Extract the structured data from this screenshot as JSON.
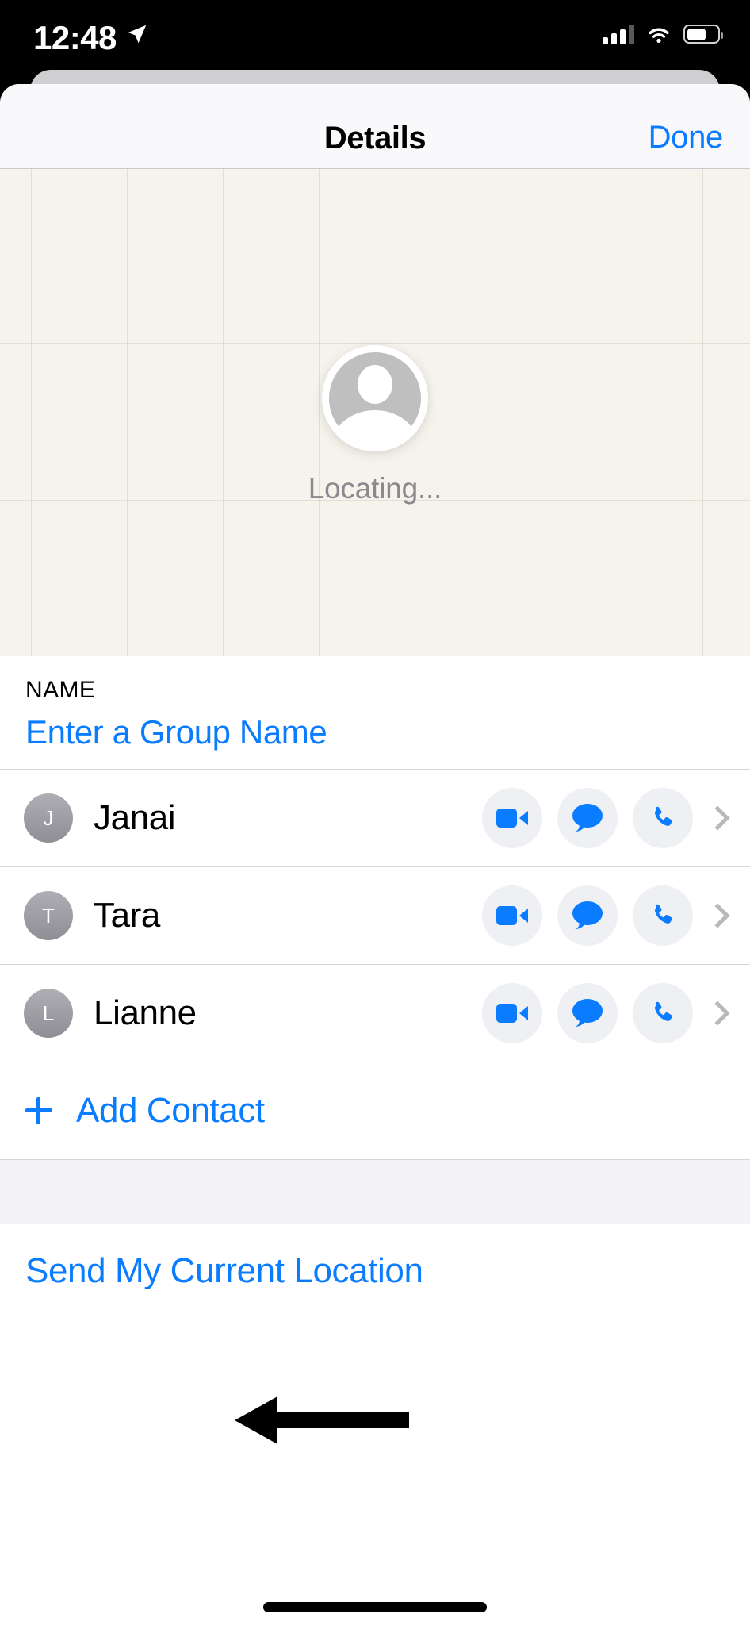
{
  "status_bar": {
    "time": "12:48",
    "location_arrow_icon": "location-arrow-icon",
    "cellular_icon": "cellular-bars-icon",
    "wifi_icon": "wifi-icon",
    "battery_icon": "battery-icon",
    "battery_level_percent": 57
  },
  "nav": {
    "title": "Details",
    "done_label": "Done"
  },
  "map": {
    "status_text": "Locating...",
    "avatar_icon": "person-placeholder-icon"
  },
  "name_section": {
    "header": "NAME",
    "placeholder": "Enter a Group Name",
    "value": ""
  },
  "contacts": [
    {
      "initial": "J",
      "name": "Janai",
      "actions": [
        "facetime-video-icon",
        "message-bubble-icon",
        "phone-icon"
      ],
      "disclosure": "chevron-right-icon"
    },
    {
      "initial": "T",
      "name": "Tara",
      "actions": [
        "facetime-video-icon",
        "message-bubble-icon",
        "phone-icon"
      ],
      "disclosure": "chevron-right-icon"
    },
    {
      "initial": "L",
      "name": "Lianne",
      "actions": [
        "facetime-video-icon",
        "message-bubble-icon",
        "phone-icon"
      ],
      "disclosure": "chevron-right-icon"
    }
  ],
  "add_contact": {
    "label": "Add Contact",
    "icon": "plus-icon"
  },
  "location_section": {
    "send_label": "Send My Current Location"
  },
  "annotation": {
    "arrow_icon": "left-pointing-arrow-annotation",
    "target": "Add Contact"
  },
  "colors": {
    "accent_blue": "#0a7cff",
    "map_background": "#f6f3ec",
    "action_pill": "#eff0f4",
    "separator": "#d6d6d8",
    "group_gap": "#f2f2f7",
    "avatar_gray": "#8e8e95"
  }
}
